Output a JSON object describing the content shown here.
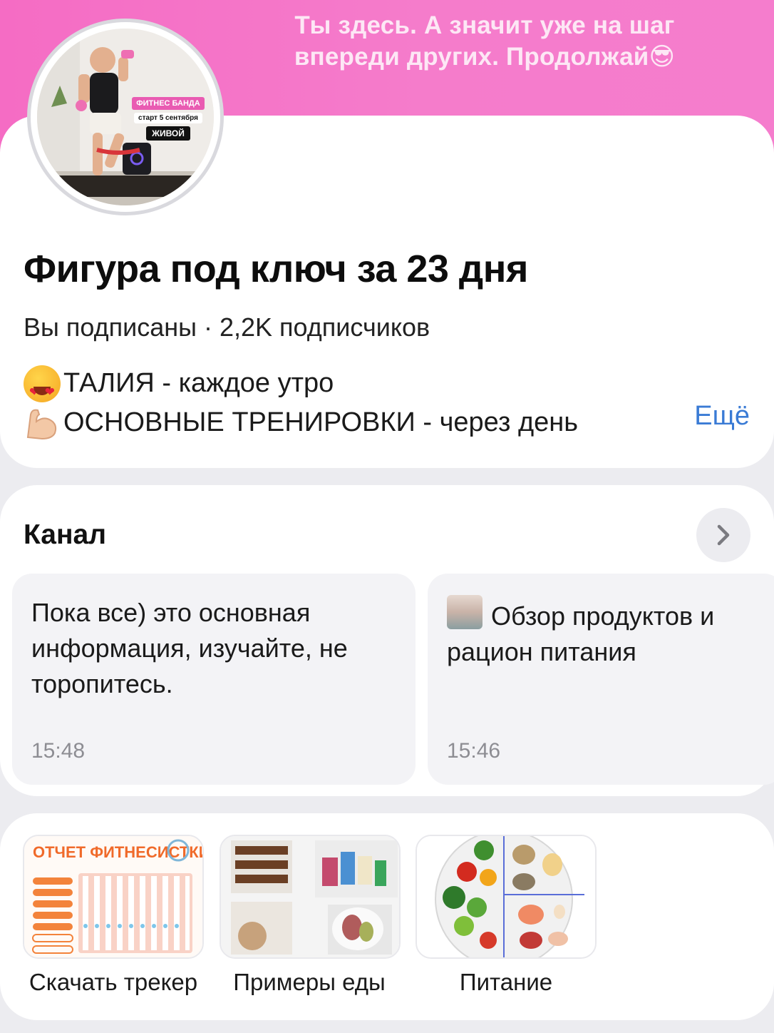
{
  "cover": {
    "text_line1": "Ты здесь. А значит уже на шаг",
    "text_line2": "впереди других. Продолжай😎"
  },
  "avatar": {
    "badge_pink": "ФИТНЕС БАНДА",
    "badge_white": "старт 5 сентября",
    "badge_black": "ЖИВОЙ"
  },
  "profile": {
    "title": "Фигура под ключ за 23 дня",
    "meta": "Вы подписаны · 2,2K подписчиков",
    "desc_line1": "ТАЛИЯ - каждое утро",
    "desc_line2": "ОСНОВНЫЕ ТРЕНИРОВКИ - через день",
    "more_label": "Ещё",
    "emoji1": "heart-eyes-emoji",
    "emoji2": "flexed-biceps-emoji"
  },
  "channel": {
    "title": "Канал",
    "posts": [
      {
        "text": "Пока все) это основная информация, изучайте, не торопитесь.",
        "time": "15:48"
      },
      {
        "text": "Обзор продуктов и рацион питания",
        "time": "15:46"
      }
    ]
  },
  "highlights": [
    {
      "label": "Скачать трекер",
      "thumb_title": "ОТЧЕТ ФИТНЕСИСТКИ"
    },
    {
      "label": "Примеры еды"
    },
    {
      "label": "Питание"
    }
  ],
  "colors": {
    "cover_pink": "#f56cc4",
    "link_blue": "#3a7bd5",
    "card_bg": "#ffffff",
    "page_bg": "#ececf0"
  }
}
